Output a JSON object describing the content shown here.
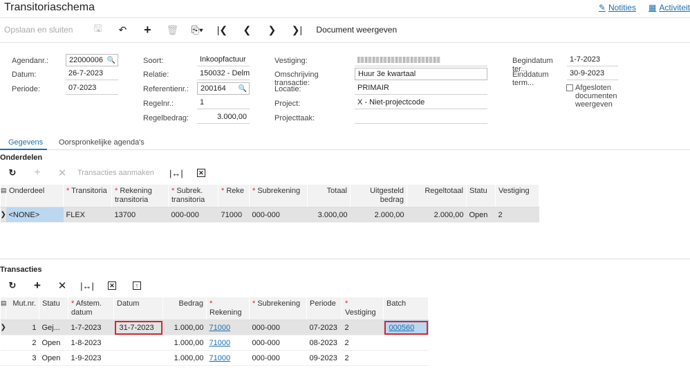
{
  "header": {
    "title": "Transitoriaschema",
    "notes_label": "Notities",
    "activities_label": "Activiteit"
  },
  "toolbar": {
    "save_close": "Opslaan en sluiten",
    "document_view": "Document weergeven"
  },
  "form": {
    "agendanr_label": "Agendanr.:",
    "agendanr": "22000006",
    "datum_label": "Datum:",
    "datum": "26-7-2023",
    "periode_label": "Periode:",
    "periode": "07-2023",
    "soort_label": "Soort:",
    "soort": "Inkoopfactuur",
    "relatie_label": "Relatie:",
    "relatie": "150032 - Delmo",
    "referentie_label": "Referentienr.:",
    "referentie": "200164",
    "regelnr_label": "Regelnr.:",
    "regelnr": "1",
    "regelbedrag_label": "Regelbedrag:",
    "regelbedrag": "3.000,00",
    "vestiging_label": "Vestiging:",
    "omschrijving_label": "Omschrijving transactie:",
    "omschrijving": "Huur 3e kwartaal",
    "locatie_label": "Locatie:",
    "locatie": "PRIMAIR",
    "project_label": "Project:",
    "project": "X - Niet-projectcode",
    "projecttaak_label": "Projecttaak:",
    "begindatum_label": "Begindatum ter...",
    "begindatum": "1-7-2023",
    "einddatum_label": "Einddatum term...",
    "einddatum": "30-9-2023",
    "afgesloten_label": "Afgesloten documenten weergeven"
  },
  "tabs": [
    "Gegevens",
    "Oorspronkelijke agenda's"
  ],
  "onderdelen": {
    "title": "Onderdelen",
    "tx_button": "Transacties aanmaken",
    "columns": [
      "Onderdeel",
      "Transitoria",
      "Rekening transitoria",
      "Subrek. transitoria",
      "Reke",
      "Subrekening",
      "Totaal",
      "Uitgesteld bedrag",
      "Regeltotaal",
      "Statu",
      "Vestiging"
    ],
    "row": [
      "<NONE>",
      "FLEX",
      "13700",
      "000-000",
      "71000",
      "000-000",
      "3.000,00",
      "2.000,00",
      "2.000,00",
      "Open",
      "2"
    ]
  },
  "transacties": {
    "title": "Transacties",
    "columns": [
      "Mut.nr.",
      "Statu",
      "Afstem. datum",
      "Datum",
      "Bedrag",
      "Rekening",
      "Subrekening",
      "Periode",
      "Vestiging",
      "Batch"
    ],
    "rows": [
      [
        "1",
        "Gej...",
        "1-7-2023",
        "31-7-2023",
        "1.000,00",
        "71000",
        "000-000",
        "07-2023",
        "2",
        "000560"
      ],
      [
        "2",
        "Open",
        "1-8-2023",
        "",
        "1.000,00",
        "71000",
        "000-000",
        "08-2023",
        "2",
        ""
      ],
      [
        "3",
        "Open",
        "1-9-2023",
        "",
        "1.000,00",
        "71000",
        "000-000",
        "09-2023",
        "2",
        ""
      ]
    ]
  },
  "colors": {
    "accent": "#1a6fb0",
    "highlight": "#d9262c"
  },
  "icons": [
    "notes-icon",
    "calendar-icon",
    "save-icon",
    "undo-icon",
    "add-icon",
    "delete-icon",
    "copy-paste-icon",
    "first-icon",
    "prev-icon",
    "next-icon",
    "last-icon",
    "refresh-icon",
    "close-icon",
    "fit-columns-icon",
    "export-excel-icon",
    "upload-icon",
    "search-icon"
  ]
}
